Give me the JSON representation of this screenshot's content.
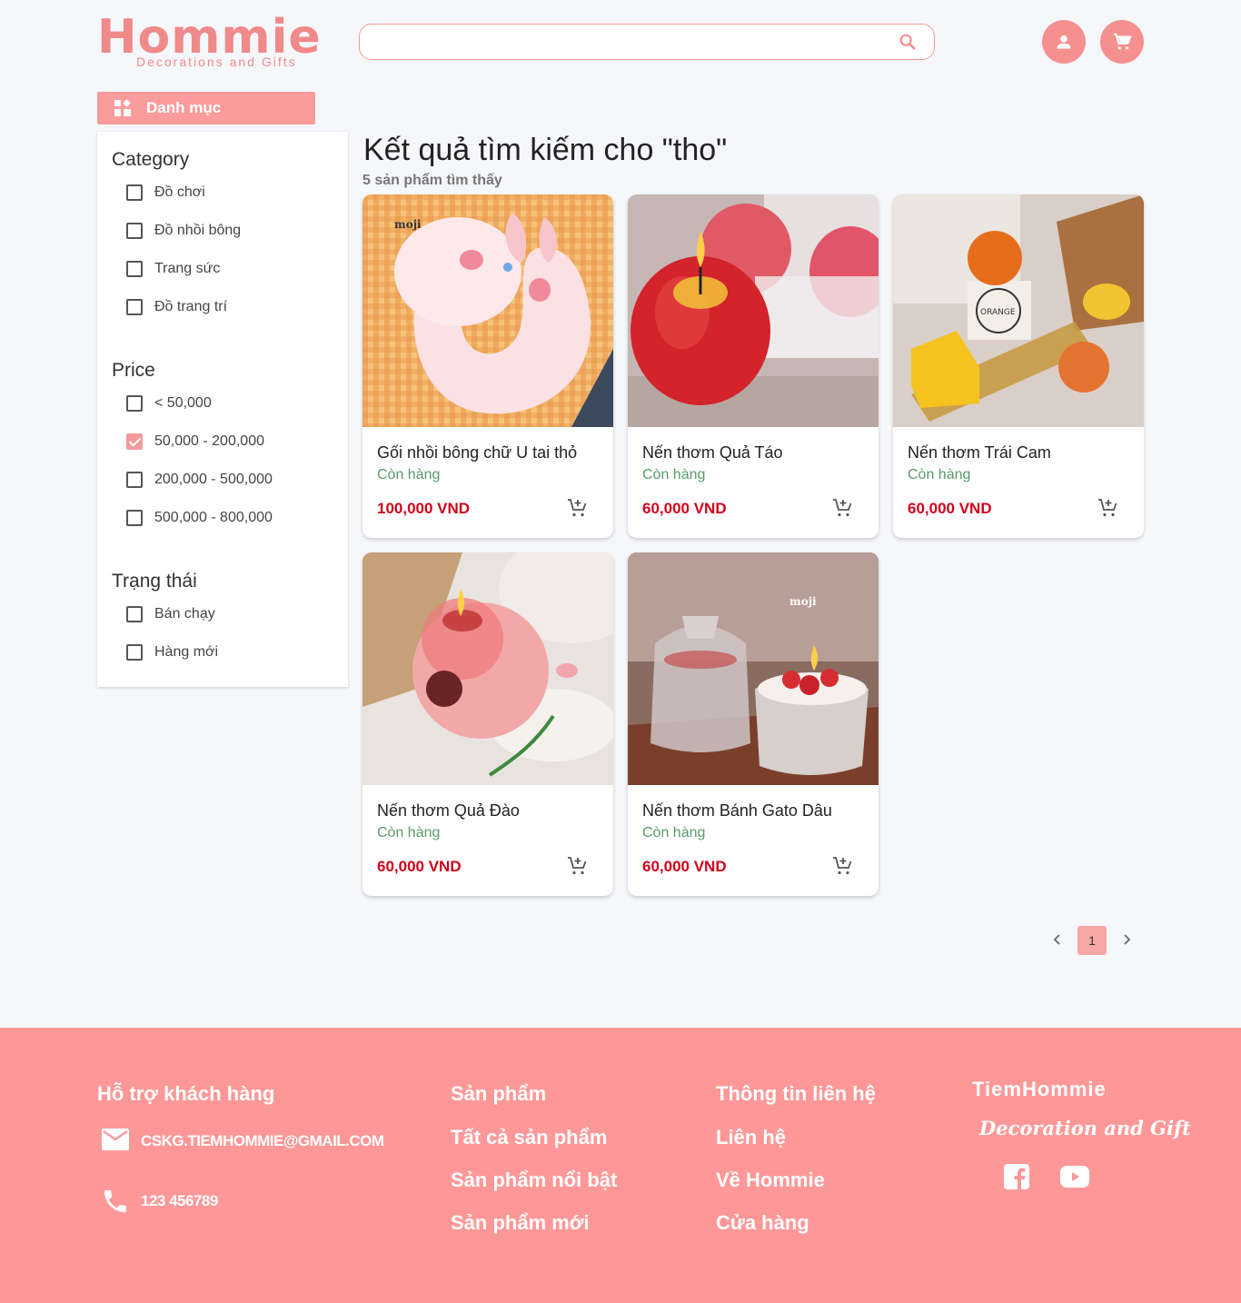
{
  "brand": {
    "logo_text": "Hommie",
    "logo_subtitle": "Decorations and Gifts",
    "accent_color": "#f5908f"
  },
  "header": {
    "search_value": "",
    "search_icon": "search-icon",
    "account_icon": "user-icon",
    "cart_icon": "cart-icon"
  },
  "category_button": {
    "label": "Danh mục",
    "icon": "grid-icon"
  },
  "filters": {
    "category": {
      "title": "Category",
      "options": [
        {
          "label": "Đồ chơi",
          "checked": false
        },
        {
          "label": "Đồ nhồi bông",
          "checked": false
        },
        {
          "label": "Trang sức",
          "checked": false
        },
        {
          "label": "Đồ trang trí",
          "checked": false
        }
      ]
    },
    "price": {
      "title": "Price",
      "options": [
        {
          "label": "< 50,000",
          "checked": false
        },
        {
          "label": "50,000 - 200,000",
          "checked": true
        },
        {
          "label": "200,000 - 500,000",
          "checked": false
        },
        {
          "label": "500,000 - 800,000",
          "checked": false
        }
      ]
    },
    "status": {
      "title": "Trạng thái",
      "options": [
        {
          "label": "Bán chạy",
          "checked": false
        },
        {
          "label": "Hàng mới",
          "checked": false
        }
      ]
    }
  },
  "results": {
    "title": "Kết quả tìm kiếm cho \"tho\"",
    "count": "5 sản phẩm tìm thấy",
    "products": [
      {
        "name": "Gối nhồi bông chữ U tai thỏ",
        "stock": "Còn hàng",
        "price": "100,000 VND"
      },
      {
        "name": "Nến thơm Quả Táo",
        "stock": "Còn hàng",
        "price": "60,000 VND"
      },
      {
        "name": "Nến thơm Trái Cam",
        "stock": "Còn hàng",
        "price": "60,000 VND"
      },
      {
        "name": "Nến thơm Quả Đào",
        "stock": "Còn hàng",
        "price": "60,000 VND"
      },
      {
        "name": "Nến thơm Bánh Gato Dâu",
        "stock": "Còn hàng",
        "price": "60,000 VND"
      }
    ]
  },
  "pagination": {
    "current": "1"
  },
  "footer": {
    "support": {
      "title": "Hỗ trợ khách hàng",
      "email": "CSKG.TIEMHOMMIE@GMAIL.COM",
      "phone": "123 456789"
    },
    "products": {
      "title": "Sản phẩm",
      "links": [
        "Tất cả sản phẩm",
        "Sản phẩm nổi bật",
        "Sản phẩm mới"
      ]
    },
    "contact": {
      "title": "Thông tin liên hệ",
      "links": [
        "Liên hệ",
        "Về Hommie",
        "Cửa hàng"
      ]
    },
    "brand_name": "TiemHommie",
    "brand_tagline": "Decoration and Gift",
    "social": [
      "facebook-icon",
      "youtube-icon"
    ]
  }
}
